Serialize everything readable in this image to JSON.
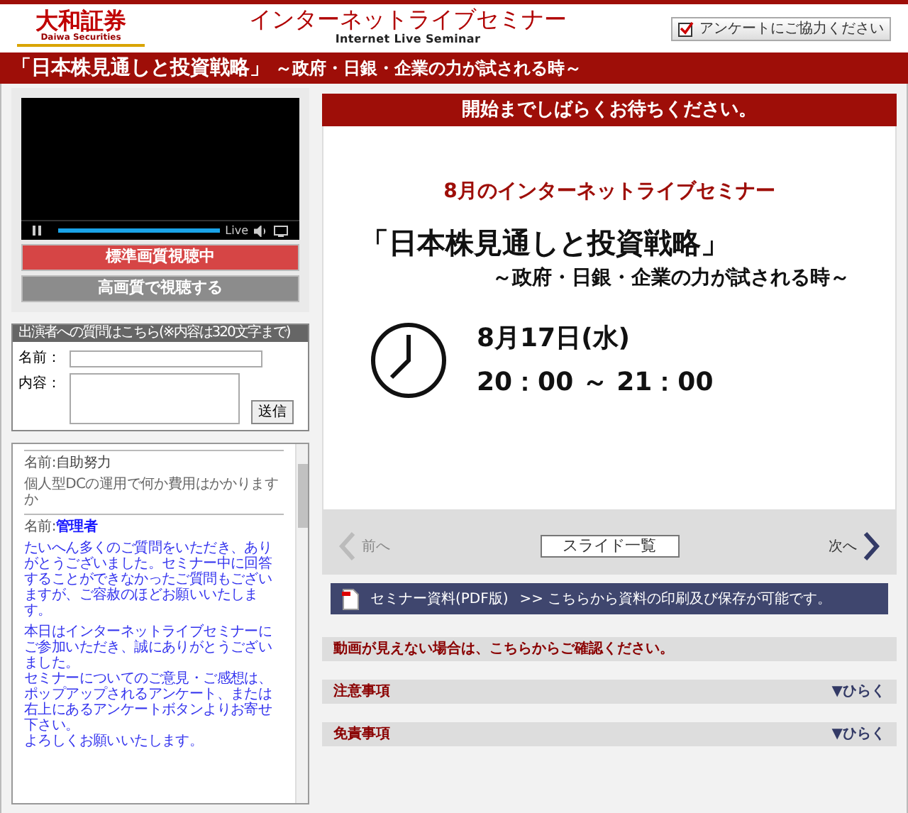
{
  "header": {
    "logo": "大和証券",
    "logo_sub": "Daiwa Securities",
    "title": "インターネットライブセミナー",
    "subtitle": "Internet Live Seminar",
    "survey_button": "アンケートにご協力ください"
  },
  "title_bar": {
    "main": "「日本株見通しと投資戦略」",
    "sub": "～政府・日銀・企業の力が試される時～"
  },
  "player": {
    "live_label": "Live",
    "level": 1
  },
  "quality_buttons": [
    {
      "label": "標準画質視聴中",
      "selected": true
    },
    {
      "label": "高画質で視聴する",
      "selected": false
    }
  ],
  "question_form": {
    "heading": "出演者への質問はこちら(※内容は320文字まで)",
    "name_label": "名前：",
    "content_label": "内容：",
    "submit": "送信"
  },
  "chat": [
    {
      "kind": "user",
      "name_prefix": "名前:",
      "name": "自助努力",
      "paragraphs": [
        [
          "個人型DCの運用で何か費用はかかりますか"
        ]
      ]
    },
    {
      "kind": "admin",
      "name_prefix": "名前:",
      "name": "管理者",
      "paragraphs": [
        [
          "たいへん多くのご質問をいただき、ありがとうございました。セミナー中に回答することができなかったご質問もございますが、ご容赦のほどお願いいたします。"
        ],
        [
          "本日はインターネットライブセミナーにご参加いただき、誠にありがとうございました。",
          "セミナーについてのご意見・ご感想は、ポップアップされるアンケート、または右上にあるアンケートボタンよりお寄せ下さい。",
          "よろしくお願いいたします。"
        ]
      ]
    }
  ],
  "status_banner": "開始までしばらくお待ちください。",
  "slide": {
    "kicker": "8月のインターネットライブセミナー",
    "title": "「日本株見通しと投資戦略」",
    "subtitle": "～政府・日銀・企業の力が試される時～",
    "date": "8月17日(水)",
    "time": "20：00 ～ 21：00"
  },
  "slide_nav": {
    "prev": {
      "label": "前へ",
      "disabled": true
    },
    "list_button": "スライド一覧",
    "next": {
      "label": "次へ",
      "disabled": false
    }
  },
  "pdf_bar": {
    "link": "セミナー資料(PDF版)",
    "text": ">> こちらから資料の印刷及び保存が可能です。"
  },
  "notice": "動画が見えない場合は、こちらからご確認ください。",
  "sections": [
    {
      "title": "注意事項",
      "toggle": "▼ひらく",
      "expanded": false
    },
    {
      "title": "免責事項",
      "toggle": "▼ひらく",
      "expanded": false
    }
  ]
}
